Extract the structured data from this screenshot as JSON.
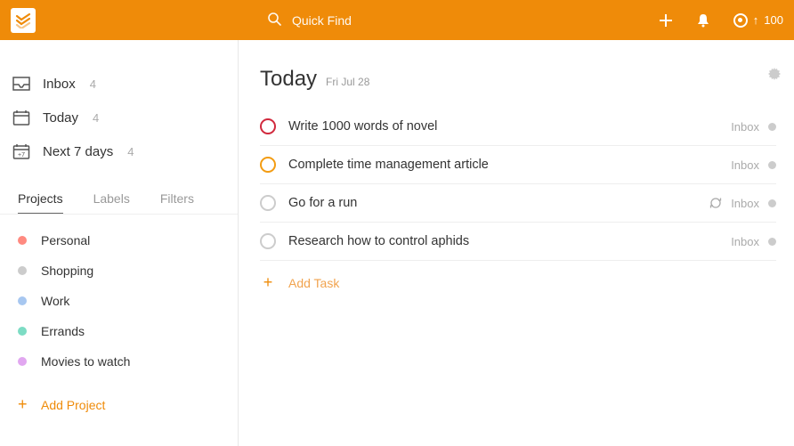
{
  "topbar": {
    "search_placeholder": "Quick Find",
    "karma": "100"
  },
  "sidebar": {
    "inbox": {
      "label": "Inbox",
      "count": "4"
    },
    "today": {
      "label": "Today",
      "count": "4"
    },
    "next7": {
      "label": "Next 7 days",
      "count": "4"
    },
    "tabs": {
      "projects": "Projects",
      "labels": "Labels",
      "filters": "Filters"
    },
    "projects": [
      {
        "name": "Personal",
        "color": "#ff8a80"
      },
      {
        "name": "Shopping",
        "color": "#cccccc"
      },
      {
        "name": "Work",
        "color": "#a7c7f0"
      },
      {
        "name": "Errands",
        "color": "#7ddcc4"
      },
      {
        "name": "Movies to watch",
        "color": "#e1a7f0"
      }
    ],
    "add_project": "Add Project"
  },
  "main": {
    "title": "Today",
    "date": "Fri Jul 28",
    "tasks": [
      {
        "title": "Write 1000 words of novel",
        "project": "Inbox",
        "priority": "p1",
        "recurring": false
      },
      {
        "title": "Complete time management article",
        "project": "Inbox",
        "priority": "p2",
        "recurring": false
      },
      {
        "title": "Go for a run",
        "project": "Inbox",
        "priority": "",
        "recurring": true
      },
      {
        "title": "Research how to control aphids",
        "project": "Inbox",
        "priority": "",
        "recurring": false
      }
    ],
    "add_task": "Add Task"
  }
}
